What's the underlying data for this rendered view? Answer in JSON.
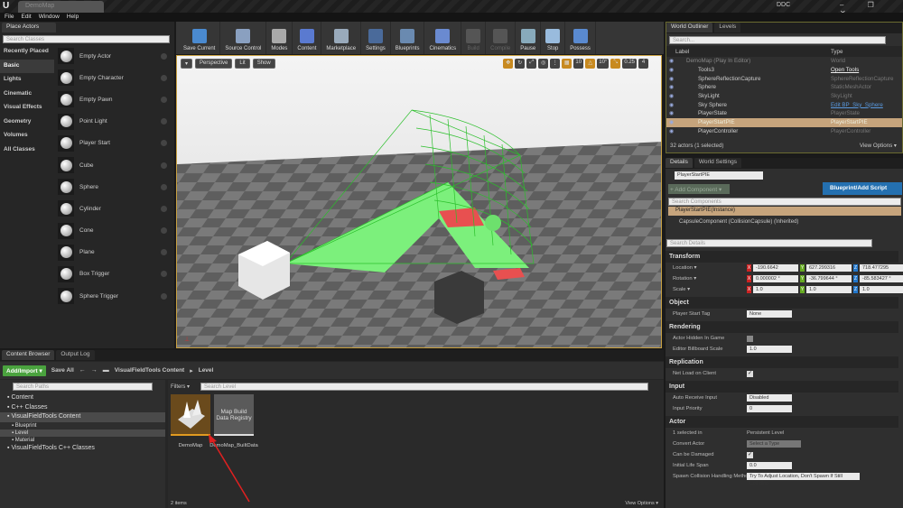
{
  "window": {
    "logo": "U",
    "map_tab": "DemoMap",
    "ddc": "DDC",
    "controls": "– ❐ ✕"
  },
  "menu": [
    "File",
    "Edit",
    "Window",
    "Help"
  ],
  "place_actors": {
    "tab": "Place Actors",
    "search_placeholder": "Search Classes",
    "categories": [
      "Recently Placed",
      "Basic",
      "Lights",
      "Cinematic",
      "Visual Effects",
      "Geometry",
      "Volumes",
      "All Classes"
    ],
    "active_category": "Basic",
    "items": [
      "Empty Actor",
      "Empty Character",
      "Empty Pawn",
      "Point Light",
      "Player Start",
      "Cube",
      "Sphere",
      "Cylinder",
      "Cone",
      "Plane",
      "Box Trigger",
      "Sphere Trigger"
    ]
  },
  "toolbar": [
    {
      "label": "Save Current",
      "color": "#4a8ad0"
    },
    {
      "label": "Source Control",
      "color": "#8aa0c0"
    },
    {
      "label": "Modes",
      "color": "#aaa"
    },
    {
      "label": "Content",
      "color": "#5a7ad0"
    },
    {
      "label": "Marketplace",
      "color": "#9ab"
    },
    {
      "label": "Settings",
      "color": "#4a6a9a"
    },
    {
      "label": "Blueprints",
      "color": "#6a8ab0"
    },
    {
      "label": "Cinematics",
      "color": "#6a8ad0"
    },
    {
      "label": "Build",
      "color": "#555",
      "disabled": true
    },
    {
      "label": "Compile",
      "color": "#555",
      "disabled": true
    },
    {
      "label": "Pause",
      "color": "#8ab"
    },
    {
      "label": "Stop",
      "color": "#9bd"
    },
    {
      "label": "Possess",
      "color": "#5a8ad0"
    }
  ],
  "viewport": {
    "menu": "▾",
    "perspective": "Perspective",
    "lit": "Lit",
    "show": "Show",
    "grid_snap": "10",
    "rotation_snap": "10°",
    "scale_snap": "0.25",
    "camera_speed": "4"
  },
  "outliner": {
    "tabs": [
      "World Outliner",
      "Levels"
    ],
    "search_placeholder": "Search...",
    "col_label": "Label",
    "col_type": "Type",
    "rows": [
      {
        "label": "DemoMap (Play In Editor)",
        "type": "World",
        "dim": true
      },
      {
        "label": "Tools3",
        "type": "Open Tools",
        "link": "white"
      },
      {
        "label": "SphereReflectionCapture",
        "type": "SphereReflectionCapture"
      },
      {
        "label": "Sphere",
        "type": "StaticMeshActor"
      },
      {
        "label": "SkyLight",
        "type": "SkyLight"
      },
      {
        "label": "Sky Sphere",
        "type": "Edit BP_Sky_Sphere",
        "link": "blue"
      },
      {
        "label": "PlayerState",
        "type": "PlayerState"
      },
      {
        "label": "PlayerStartPIE",
        "type": "PlayerStartPIE",
        "selected": true
      },
      {
        "label": "PlayerController",
        "type": "PlayerController"
      }
    ],
    "status": "32 actors (1 selected)",
    "view_options": "View Options ▾"
  },
  "details": {
    "tabs": [
      "Details",
      "World Settings"
    ],
    "name": "PlayerStartPIE",
    "add_component": "+ Add Component ▾",
    "blueprint_button": "Blueprint/Add Script",
    "search_components": "Search Components",
    "instance": "PlayerStartPIE(Instance)",
    "component": "CapsuleComponent (CollisionCapsule) (Inherited)",
    "search_details": "Search Details",
    "transform": {
      "title": "Transform",
      "location_label": "Location ▾",
      "location": [
        "-190.6642",
        "627.299316",
        "718.477295"
      ],
      "rotation_label": "Rotation ▾",
      "rotation": [
        "0.000002 °",
        "-36.799644 °",
        "-85.583427 °"
      ],
      "scale_label": "Scale ▾",
      "scale": [
        "1.0",
        "1.0",
        "1.0"
      ]
    },
    "object": {
      "title": "Object",
      "player_start_tag_label": "Player Start Tag",
      "player_start_tag": "None"
    },
    "rendering": {
      "title": "Rendering",
      "hidden_label": "Actor Hidden In Game",
      "hidden": false,
      "billboard_label": "Editor Billboard Scale",
      "billboard": "1.0"
    },
    "replication": {
      "title": "Replication",
      "net_load_label": "Net Load on Client",
      "net_load": true
    },
    "input": {
      "title": "Input",
      "auto_receive_label": "Auto Receive Input",
      "auto_receive": "Disabled",
      "priority_label": "Input Priority",
      "priority": "0"
    },
    "actor": {
      "title": "Actor",
      "selected_in_label": "1 selected in",
      "selected_in": "Persistent Level",
      "convert_label": "Convert Actor",
      "convert": "Select a Type",
      "damaged_label": "Can be Damaged",
      "damaged": true,
      "lifespan_label": "Initial Life Span",
      "lifespan": "0.0",
      "spawn_label": "Spawn Collision Handling Method",
      "spawn": "Try To Adjust Location, Don't Spawn If Still Colliding"
    }
  },
  "content_browser": {
    "tabs": [
      "Content Browser",
      "Output Log"
    ],
    "add_import": "Add/Import ▾",
    "save_all": "Save All",
    "breadcrumb": [
      "VisualFieldTools Content",
      "Level"
    ],
    "search_paths": "Search Paths",
    "filters": "Filters ▾",
    "search_level": "Search Level",
    "tree": [
      {
        "label": "Content",
        "level": 0
      },
      {
        "label": "C++ Classes",
        "level": 0
      },
      {
        "label": "VisualFieldTools Content",
        "level": 0,
        "hl": true
      },
      {
        "label": "Blueprint",
        "level": 1
      },
      {
        "label": "Level",
        "level": 1,
        "hl": true
      },
      {
        "label": "Material",
        "level": 1
      },
      {
        "label": "VisualFieldTools C++ Classes",
        "level": 0
      }
    ],
    "assets": [
      {
        "name": "DemoMap",
        "thumb": ""
      },
      {
        "name": "DemoMap_BuiltData",
        "thumb": "Map Build Data Registry"
      }
    ],
    "count": "2 items",
    "view_options": "View Options ▾"
  }
}
